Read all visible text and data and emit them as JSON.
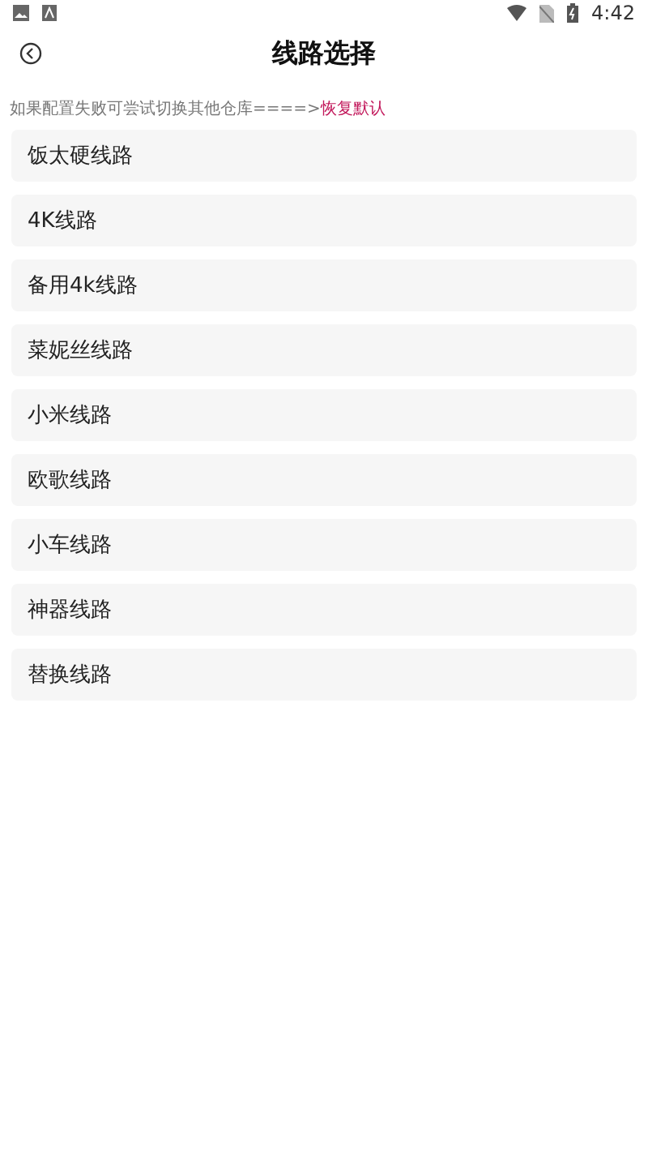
{
  "status_bar": {
    "time": "4:42"
  },
  "header": {
    "title": "线路选择"
  },
  "hint": {
    "text": "如果配置失败可尝试切换其他仓库====>",
    "link": "恢复默认"
  },
  "routes": [
    {
      "label": "饭太硬线路"
    },
    {
      "label": "4K线路"
    },
    {
      "label": "备用4k线路"
    },
    {
      "label": "菜妮丝线路"
    },
    {
      "label": "小米线路"
    },
    {
      "label": "欧歌线路"
    },
    {
      "label": "小车线路"
    },
    {
      "label": "神器线路"
    },
    {
      "label": "替换线路"
    }
  ]
}
